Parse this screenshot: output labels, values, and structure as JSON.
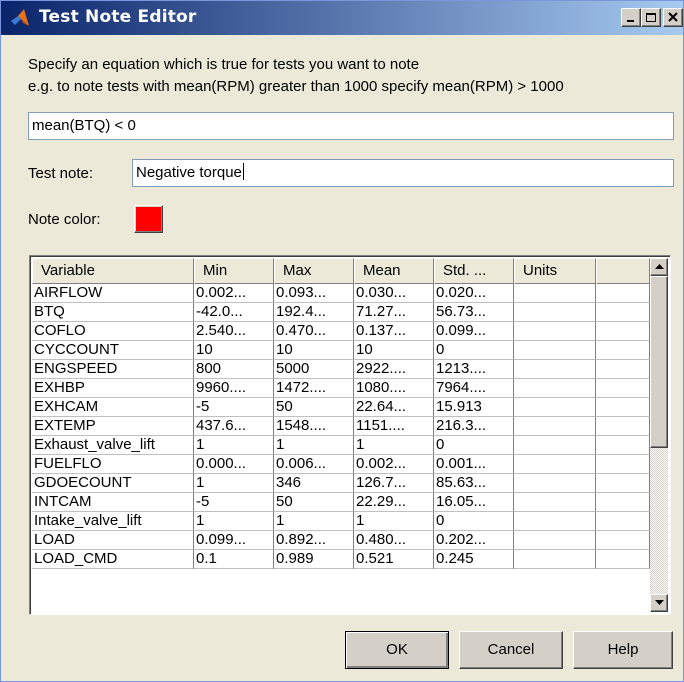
{
  "window": {
    "title": "Test Note Editor",
    "controls": {
      "minimize": "_",
      "maximize": "□",
      "close": "×"
    }
  },
  "instructions": {
    "line1": "Specify an equation which is true for tests you want to note",
    "line2": "e.g. to note tests with mean(RPM) greater than 1000 specify mean(RPM) > 1000"
  },
  "equation": {
    "value": "mean(BTQ) < 0"
  },
  "test_note": {
    "label": "Test note:",
    "value": "Negative torque"
  },
  "note_color": {
    "label": "Note color:",
    "color": "#ff0000"
  },
  "table": {
    "columns": [
      "Variable",
      "Min",
      "Max",
      "Mean",
      "Std. ...",
      "Units",
      ""
    ],
    "rows": [
      [
        "AIRFLOW",
        "0.002...",
        "0.093...",
        "0.030...",
        "0.020...",
        "",
        ""
      ],
      [
        "BTQ",
        "-42.0...",
        "192.4...",
        "71.27...",
        "56.73...",
        "",
        ""
      ],
      [
        "COFLO",
        "2.540...",
        "0.470...",
        "0.137...",
        "0.099...",
        "",
        ""
      ],
      [
        "CYCCOUNT",
        "10",
        "10",
        "10",
        "0",
        "",
        ""
      ],
      [
        "ENGSPEED",
        "800",
        "5000",
        "2922....",
        "1213....",
        "",
        ""
      ],
      [
        "EXHBP",
        "9960....",
        "1472....",
        "1080....",
        "7964....",
        "",
        ""
      ],
      [
        "EXHCAM",
        "-5",
        "50",
        "22.64...",
        "15.913",
        "",
        ""
      ],
      [
        "EXTEMP",
        "437.6...",
        "1548....",
        "1151....",
        "216.3...",
        "",
        ""
      ],
      [
        "Exhaust_valve_lift",
        "1",
        "1",
        "1",
        "0",
        "",
        ""
      ],
      [
        "FUELFLO",
        "0.000...",
        "0.006...",
        "0.002...",
        "0.001...",
        "",
        ""
      ],
      [
        "GDOECOUNT",
        "1",
        "346",
        "126.7...",
        "85.63...",
        "",
        ""
      ],
      [
        "INTCAM",
        "-5",
        "50",
        "22.29...",
        "16.05...",
        "",
        ""
      ],
      [
        "Intake_valve_lift",
        "1",
        "1",
        "1",
        "0",
        "",
        ""
      ],
      [
        "LOAD",
        "0.099...",
        "0.892...",
        "0.480...",
        "0.202...",
        "",
        ""
      ],
      [
        "LOAD_CMD",
        "0.1",
        "0.989",
        "0.521",
        "0.245",
        "",
        ""
      ]
    ]
  },
  "buttons": {
    "ok": "OK",
    "cancel": "Cancel",
    "help": "Help"
  },
  "icons": {
    "app": "matlab-logo-icon",
    "scroll_up": "arrow-up-icon",
    "scroll_down": "arrow-down-icon"
  }
}
